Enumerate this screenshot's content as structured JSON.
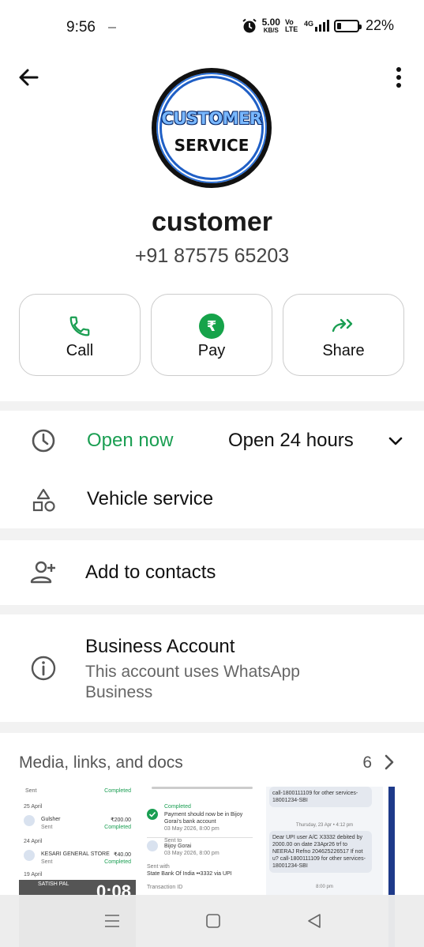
{
  "status": {
    "time": "9:56",
    "speed_value": "5.00",
    "speed_unit": "KB/S",
    "volte": "Vo LTE",
    "network": "4G",
    "battery": "22%"
  },
  "avatar": {
    "line1": "CUSTOMER",
    "line2": "SERVICE"
  },
  "contact": {
    "name": "customer",
    "phone": "+91 87575 65203"
  },
  "actions": [
    {
      "label": "Call",
      "icon": "phone-icon"
    },
    {
      "label": "Pay",
      "icon": "rupee-icon"
    },
    {
      "label": "Share",
      "icon": "share-icon"
    }
  ],
  "hours": {
    "status": "Open now",
    "detail": "Open 24 hours"
  },
  "category": "Vehicle service",
  "add_contacts": "Add to contacts",
  "business": {
    "title": "Business Account",
    "desc": "This account uses WhatsApp Business"
  },
  "media": {
    "title": "Media, links, and docs",
    "count": "6"
  },
  "thumb1": {
    "rows": [
      {
        "label": "Sent",
        "status": "Completed"
      },
      {
        "date": "25 April"
      },
      {
        "name": "Gulsher",
        "sub": "Sent",
        "amount": "₹200.00",
        "status": "Completed"
      },
      {
        "date": "24 April"
      },
      {
        "name": "KESARI GENERAL STORE",
        "sub": "Sent",
        "amount": "₹40.00",
        "status": "Completed"
      },
      {
        "date": "19 April"
      },
      {
        "name": "SATISH PAL",
        "timer": "0:08"
      }
    ]
  },
  "thumb2": {
    "status": "Completed",
    "line1": "Payment should now be in Bijoy Gorai's bank account",
    "date": "03 May 2026, 8:00 pm",
    "sent_to_label": "Sent to",
    "sent_to": "Bijoy Gorai",
    "sent_date": "03 May 2026, 8:00 pm",
    "sent_with_label": "Sent with",
    "sent_with": "State Bank Of India ••3332 via UPI",
    "txn_label": "Transaction ID"
  },
  "thumb3": {
    "top": "call-1800111109 for other services-18001234-SBI",
    "date": "Thursday, 23 Apr • 4:12 pm",
    "msg": "Dear UPI user A/C X3332 debited by 2000.00 on date 23Apr26 trf to NEERAJ Refno 204625226517 If not u? call-1800111109 for other services-18001234-SBI",
    "time": "8:00 pm"
  },
  "colors": {
    "green": "#1a9e52",
    "pay_green": "#16a34a"
  }
}
